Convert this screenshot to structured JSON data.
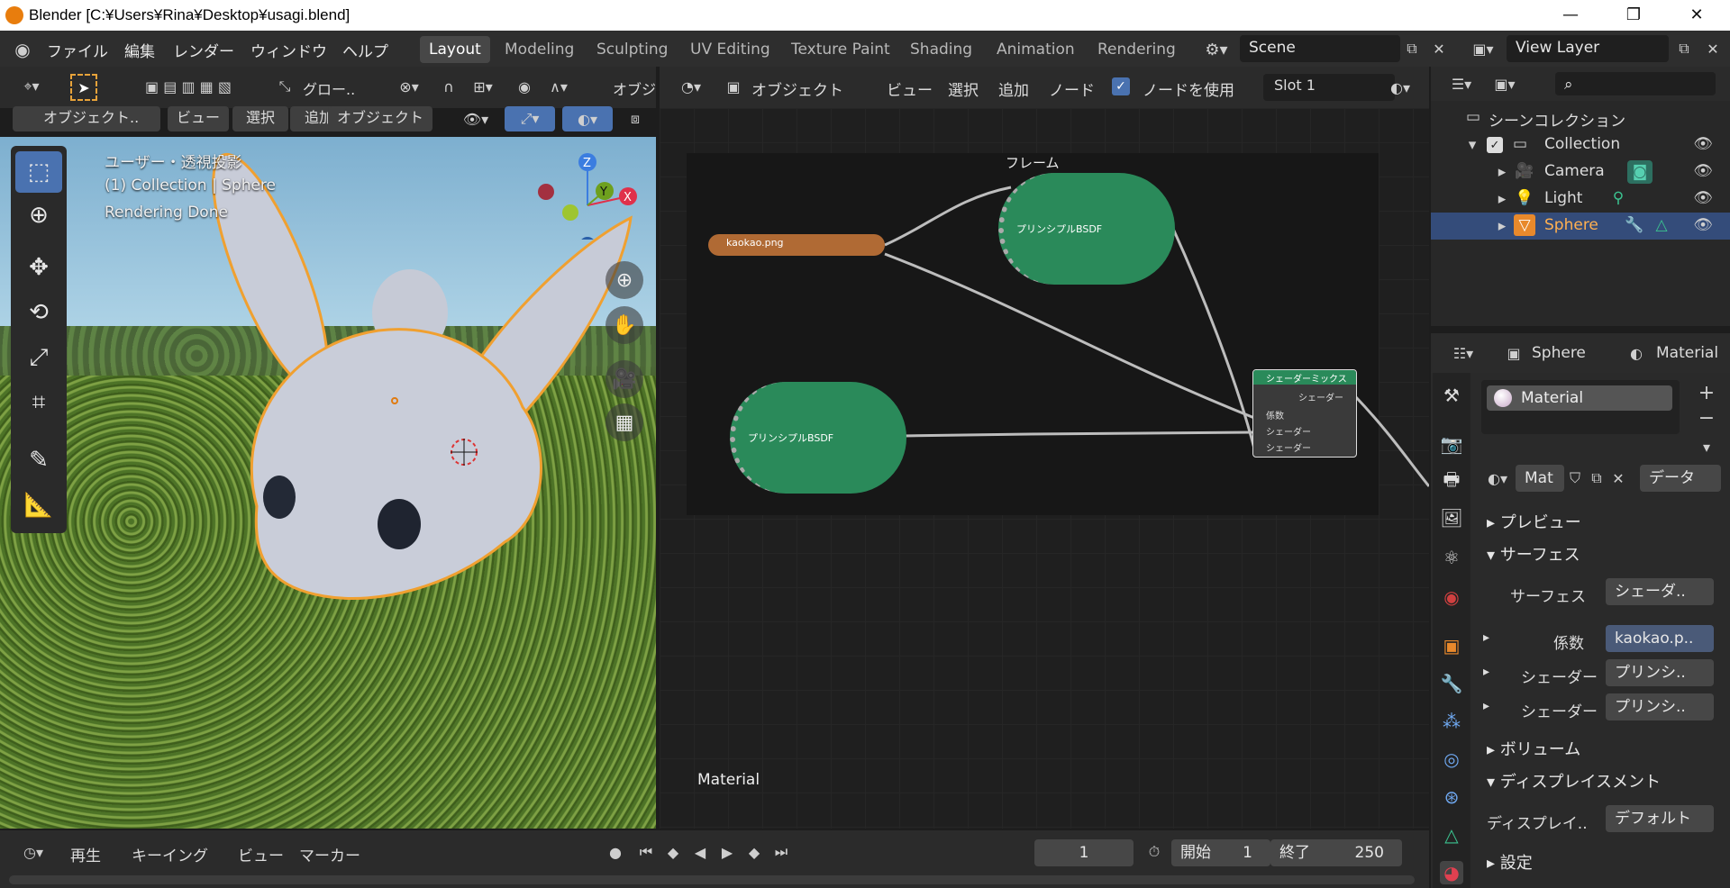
{
  "app": {
    "title": "Blender [C:¥Users¥Rina¥Desktop¥usagi.blend]"
  },
  "menus": [
    "ファイル",
    "編集",
    "レンダー",
    "ウィンドウ",
    "ヘルプ"
  ],
  "workspaces": [
    "Layout",
    "Modeling",
    "Sculpting",
    "UV Editing",
    "Texture Paint",
    "Shading",
    "Animation",
    "Rendering"
  ],
  "scene": {
    "name": "Scene"
  },
  "view_layer": {
    "name": "View Layer"
  },
  "viewport_header": {
    "transform": "グロー..",
    "mode": "オブジェクト..",
    "view": "ビュー",
    "select": "選択",
    "add": "追加",
    "object": "オブジェクト",
    "cut": "オブジ"
  },
  "viewport_info": {
    "projection": "ユーザー・透視投影",
    "collection": "(1) Collection | Sphere",
    "status": "Rendering Done"
  },
  "gizmo": {
    "z": "Z",
    "y": "Y",
    "x": "X"
  },
  "node_header": {
    "object": "オブジェクト",
    "view": "ビュー",
    "select": "選択",
    "add": "追加",
    "node": "ノード",
    "use_nodes": "ノードを使用",
    "slot": "Slot 1"
  },
  "nodes": {
    "frame_label": "フレーム",
    "image": "kaokao.png",
    "bsdf_top": "プリンシプルBSDF",
    "bsdf_bottom": "プリンシプルBSDF",
    "mix": "シェーダーミックス",
    "mix_out": "シェーダー",
    "mix_fac": "係数",
    "mix_in1": "シェーダー",
    "mix_in2": "シェーダー",
    "material_label": "Material"
  },
  "outliner": {
    "root": "シーンコレクション",
    "collection": "Collection",
    "items": [
      "Camera",
      "Light",
      "Sphere"
    ]
  },
  "properties": {
    "object": "Sphere",
    "material_tab": "Material",
    "slot": "Material",
    "mat_name": "Mat",
    "data_link": "データ",
    "preview": "プレビュー",
    "surface_section": "サーフェス",
    "surface_label": "サーフェス",
    "surface_value": "シェーダ..",
    "fac_label": "係数",
    "fac_value": "kaokao.p..",
    "shader1_label": "シェーダー",
    "shader1_value": "プリンシ..",
    "shader2_label": "シェーダー",
    "shader2_value": "プリンシ..",
    "volume": "ボリューム",
    "displacement": "ディスプレイスメント",
    "disp_label": "ディスプレイ..",
    "disp_value": "デフォルト",
    "settings": "設定"
  },
  "timeline": {
    "play": "再生",
    "keying": "キーイング",
    "view": "ビュー",
    "marker": "マーカー",
    "frame": "1",
    "start_label": "開始",
    "start": "1",
    "end_label": "終了",
    "end": "250"
  }
}
